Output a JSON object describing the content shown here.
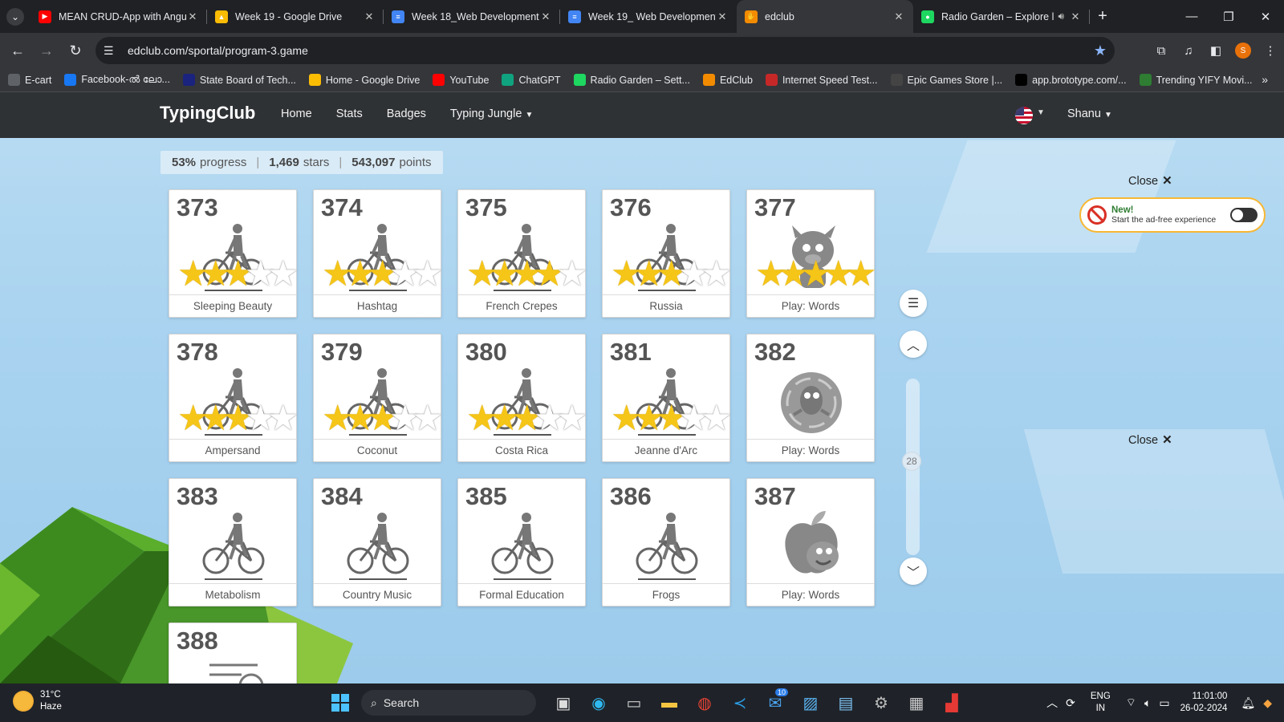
{
  "tabs": [
    {
      "title": "MEAN CRUD-App with Angu",
      "fav_color": "#ff0000",
      "fav_text": "▶"
    },
    {
      "title": "Week 19 - Google Drive",
      "fav_color": "#fbbc04",
      "fav_text": "▲"
    },
    {
      "title": "Week 18_Web Development",
      "fav_color": "#4285f4",
      "fav_text": "≡"
    },
    {
      "title": "Week 19_ Web Development",
      "fav_color": "#4285f4",
      "fav_text": "≡"
    },
    {
      "title": "edclub",
      "fav_color": "#f28b00",
      "fav_text": "✋"
    },
    {
      "title": "Radio Garden – Explore l",
      "fav_color": "#1ed760",
      "fav_text": "●"
    }
  ],
  "address": {
    "url": "edclub.com/sportal/program-3.game"
  },
  "bookmarks": [
    {
      "label": "E-cart",
      "color": "#5f6368"
    },
    {
      "label": "Facebook-ൽ ലോ...",
      "color": "#1877f2"
    },
    {
      "label": "State Board of Tech...",
      "color": "#1a237e"
    },
    {
      "label": "Home - Google Drive",
      "color": "#fbbc04"
    },
    {
      "label": "YouTube",
      "color": "#ff0000"
    },
    {
      "label": "ChatGPT",
      "color": "#10a37f"
    },
    {
      "label": "Radio Garden – Sett...",
      "color": "#1ed760"
    },
    {
      "label": "EdClub",
      "color": "#f28b00"
    },
    {
      "label": "Internet Speed Test...",
      "color": "#c62828"
    },
    {
      "label": "Epic Games Store |...",
      "color": "#444444"
    },
    {
      "label": "app.brototype.com/...",
      "color": "#000000"
    },
    {
      "label": "Trending YIFY Movi...",
      "color": "#2e7d32"
    }
  ],
  "site": {
    "brand": "TypingClub",
    "nav": [
      "Home",
      "Stats",
      "Badges",
      "Typing Jungle"
    ],
    "user": "Shanu"
  },
  "stats": {
    "progress": "53%",
    "progress_label": "progress",
    "stars": "1,469",
    "stars_label": "stars",
    "points": "543,097",
    "points_label": "points"
  },
  "lessons": [
    {
      "num": "373",
      "label": "Sleeping Beauty",
      "icon": "bicycle-icon",
      "stars": 2.5
    },
    {
      "num": "374",
      "label": "Hashtag",
      "icon": "bicycle-icon",
      "stars": 2.5
    },
    {
      "num": "375",
      "label": "French Crepes",
      "icon": "bicycle-icon",
      "stars": 3.5
    },
    {
      "num": "376",
      "label": "Russia",
      "icon": "bicycle-icon",
      "stars": 2.5
    },
    {
      "num": "377",
      "label": "Play: Words",
      "icon": "monster-icon",
      "stars": 5
    },
    {
      "num": "378",
      "label": "Ampersand",
      "icon": "bicycle-icon",
      "stars": 2.5
    },
    {
      "num": "379",
      "label": "Coconut",
      "icon": "bicycle-icon",
      "stars": 2.5
    },
    {
      "num": "380",
      "label": "Costa Rica",
      "icon": "bicycle-icon",
      "stars": 2.5
    },
    {
      "num": "381",
      "label": "Jeanne d'Arc",
      "icon": "bicycle-icon",
      "stars": 2.5
    },
    {
      "num": "382",
      "label": "Play: Words",
      "icon": "game-badge-icon",
      "stars": 0
    },
    {
      "num": "383",
      "label": "Metabolism",
      "icon": "bicycle-icon",
      "stars": 0
    },
    {
      "num": "384",
      "label": "Country Music",
      "icon": "bicycle-icon",
      "stars": 0
    },
    {
      "num": "385",
      "label": "Formal Education",
      "icon": "bicycle-icon",
      "stars": 0
    },
    {
      "num": "386",
      "label": "Frogs",
      "icon": "bicycle-icon",
      "stars": 0
    },
    {
      "num": "387",
      "label": "Play: Words",
      "icon": "apple-monster-icon",
      "stars": 0
    },
    {
      "num": "388",
      "label": "",
      "icon": "document-icon",
      "stars": 0
    }
  ],
  "scroll": {
    "page": "28"
  },
  "ads": {
    "close_label": "Close",
    "new_label": "New!",
    "adfree_text": "Start the ad-free experience"
  },
  "taskbar": {
    "temp": "31°C",
    "weather": "Haze",
    "search_placeholder": "Search",
    "lang1": "ENG",
    "lang2": "IN",
    "time": "11:01:00",
    "date": "26-02-2024",
    "mail_badge": "10",
    "chrome_badge": "S"
  }
}
